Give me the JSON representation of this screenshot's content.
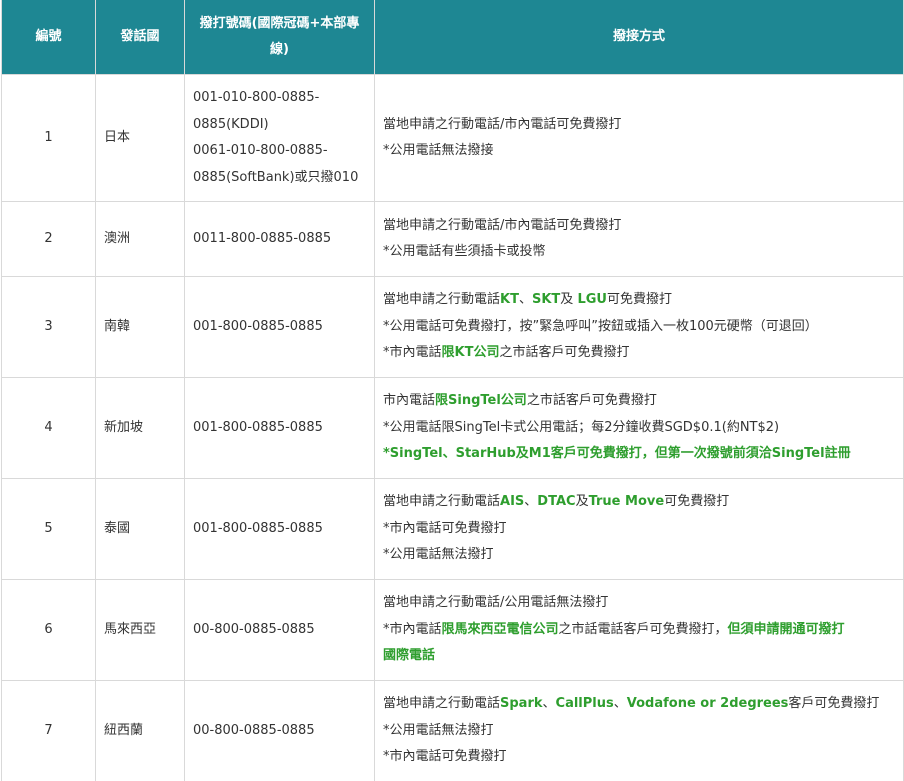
{
  "headers": [
    "編號",
    "發話國",
    "撥打號碼(國際冠碼+本部專線)",
    "撥接方式"
  ],
  "rows": [
    {
      "num": "1",
      "country": "日本",
      "phone_lines": [
        "001-010-800-0885-",
        "0885(KDDI)",
        "0061-010-800-0885-",
        "0885(SoftBank)或只撥010"
      ],
      "method_lines": [
        [
          {
            "t": "當地申請之行動電話/市內電話可免費撥打"
          }
        ],
        [
          {
            "t": "*公用電話無法撥接"
          }
        ]
      ]
    },
    {
      "num": "2",
      "country": "澳洲",
      "phone_lines": [
        "0011-800-0885-0885"
      ],
      "method_lines": [
        [
          {
            "t": "當地申請之行動電話/市內電話可免費撥打"
          }
        ],
        [
          {
            "t": "*公用電話有些須插卡或投幣"
          }
        ]
      ]
    },
    {
      "num": "3",
      "country": "南韓",
      "phone_lines": [
        "001-800-0885-0885"
      ],
      "method_lines": [
        [
          {
            "t": "當地申請之行動電話"
          },
          {
            "t": "KT",
            "g": true
          },
          {
            "t": "、"
          },
          {
            "t": "SKT",
            "g": true
          },
          {
            "t": "及 "
          },
          {
            "t": "LGU",
            "g": true
          },
          {
            "t": "可免費撥打"
          }
        ],
        [
          {
            "t": "*公用電話可免費撥打，按”緊急呼叫”按鈕或插入一枚100元硬幣（可退回）"
          }
        ],
        [
          {
            "t": "*市內電話"
          },
          {
            "t": "限KT公司",
            "g": true
          },
          {
            "t": "之市話客戶可免費撥打"
          }
        ]
      ]
    },
    {
      "num": "4",
      "country": "新加坡",
      "phone_lines": [
        "001-800-0885-0885"
      ],
      "method_lines": [
        [
          {
            "t": "市內電話"
          },
          {
            "t": "限SingTel公司",
            "g": true
          },
          {
            "t": "之市話客戶可免費撥打"
          }
        ],
        [
          {
            "t": "*公用電話限SingTel卡式公用電話；每2分鐘收費SGD$0.1(約NT$2)"
          }
        ],
        [
          {
            "t": "*SingTel、StarHub及M1客戶可免費撥打，但第一次撥號前須洽SingTel註冊",
            "g": true
          }
        ]
      ]
    },
    {
      "num": "5",
      "country": "泰國",
      "phone_lines": [
        "001-800-0885-0885"
      ],
      "method_lines": [
        [
          {
            "t": "當地申請之行動電話"
          },
          {
            "t": "AIS",
            "g": true
          },
          {
            "t": "、"
          },
          {
            "t": "DTAC",
            "g": true
          },
          {
            "t": "及"
          },
          {
            "t": "True Move",
            "g": true
          },
          {
            "t": "可免費撥打"
          }
        ],
        [
          {
            "t": "*市內電話可免費撥打"
          }
        ],
        [
          {
            "t": "*公用電話無法撥打"
          }
        ]
      ]
    },
    {
      "num": "6",
      "country": "馬來西亞",
      "phone_lines": [
        "00-800-0885-0885"
      ],
      "method_lines": [
        [
          {
            "t": "當地申請之行動電話/公用電話無法撥打"
          }
        ],
        [
          {
            "t": "*市內電話"
          },
          {
            "t": "限馬來西亞電信公司",
            "g": true
          },
          {
            "t": "之市話電話客戶可免費撥打，"
          },
          {
            "t": "但須申請開通可撥打",
            "g": true
          }
        ],
        [
          {
            "t": "國際電話",
            "g": true
          }
        ]
      ]
    },
    {
      "num": "7",
      "country": "紐西蘭",
      "phone_lines": [
        "00-800-0885-0885"
      ],
      "method_lines": [
        [
          {
            "t": "當地申請之行動電話"
          },
          {
            "t": "Spark",
            "g": true
          },
          {
            "t": "、"
          },
          {
            "t": "CallPlus",
            "g": true
          },
          {
            "t": "、"
          },
          {
            "t": "Vodafone or 2degrees",
            "g": true
          },
          {
            "t": "客戶可免費撥打"
          }
        ],
        [
          {
            "t": "*公用電話無法撥打"
          }
        ],
        [
          {
            "t": "*市內電話可免費撥打"
          }
        ]
      ]
    }
  ],
  "colors": {
    "header_bg": "#1e8793",
    "highlight_text": "#2e9e2e"
  }
}
